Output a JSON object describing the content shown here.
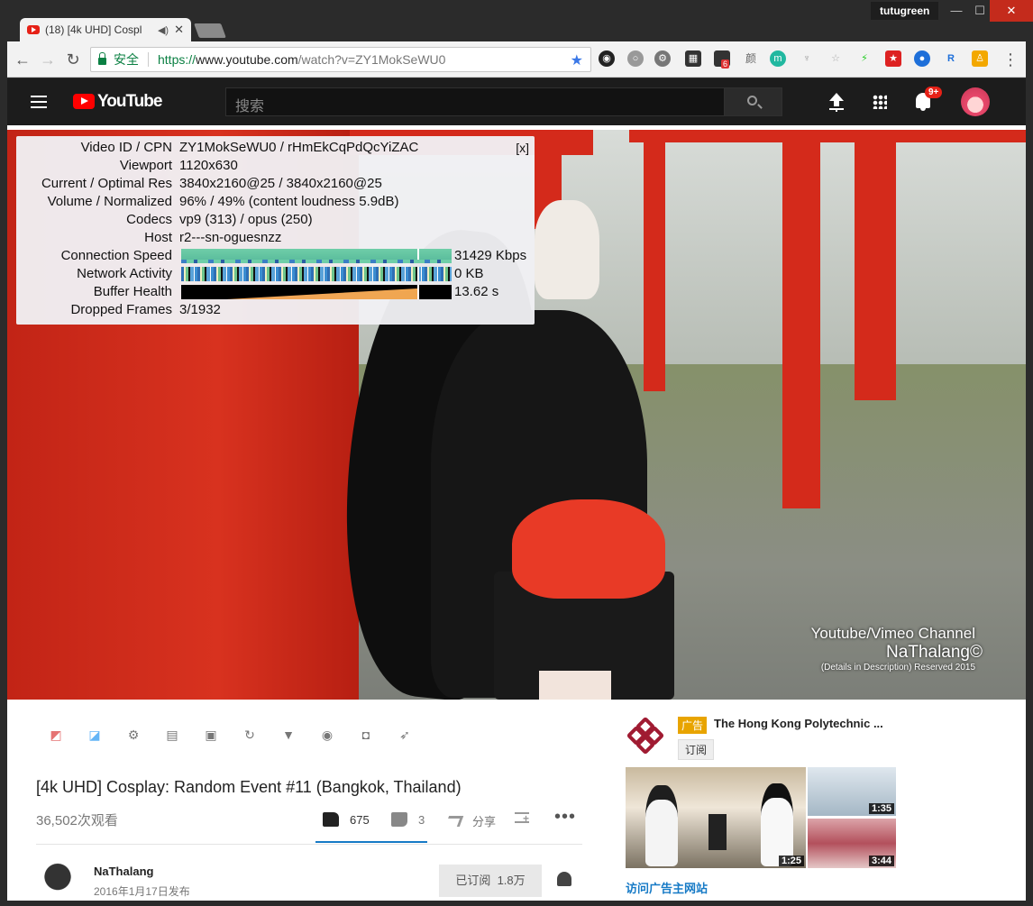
{
  "browser": {
    "tab_title": "(18) [4k UHD] Cospl",
    "tab_audio_icon": "speaker-icon",
    "user_name": "tutugreen",
    "secure_label": "安全",
    "url_scheme": "https://",
    "url_host": "www.youtube.com",
    "url_path": "/watch?v=ZY1MokSeWU0",
    "extension_badge": "6",
    "ext_text_yan": "颜"
  },
  "header": {
    "logo_text": "YouTube",
    "search_placeholder": "搜索",
    "notifications_badge": "9+"
  },
  "stats": {
    "close_label": "[x]",
    "rows": [
      {
        "key": "Video ID / CPN",
        "value": "ZY1MokSeWU0 / rHmEkCqPdQcYiZAC"
      },
      {
        "key": "Viewport",
        "value": "1120x630"
      },
      {
        "key": "Current / Optimal Res",
        "value": "3840x2160@25 / 3840x2160@25"
      },
      {
        "key": "Volume / Normalized",
        "value": "96% / 49% (content loudness 5.9dB)"
      },
      {
        "key": "Codecs",
        "value": "vp9 (313) / opus (250)"
      },
      {
        "key": "Host",
        "value": "r2---sn-oguesnzz"
      },
      {
        "key": "Connection Speed",
        "value": "31429 Kbps"
      },
      {
        "key": "Network Activity",
        "value": "0 KB"
      },
      {
        "key": "Buffer Health",
        "value": "13.62 s"
      },
      {
        "key": "Dropped Frames",
        "value": "3/1932"
      }
    ]
  },
  "watermark": {
    "line1": "Youtube/Vimeo Channel",
    "line2": "NaThalang©",
    "line3": "(Details in Description) Reserved 2015"
  },
  "video": {
    "title": "[4k UHD] Cosplay: Random Event #11 (Bangkok, Thailand)",
    "views": "36,502次观看",
    "likes": "675",
    "dislikes": "3",
    "share_label": "分享",
    "channel_name": "NaThalang",
    "published": "2016年1月17日发布",
    "subscribe_label": "已订阅",
    "subscriber_count": "1.8万"
  },
  "action_icons": [
    "pip-icon",
    "popout-icon",
    "gear-icon",
    "film-icon",
    "screenshot-icon",
    "loop-icon",
    "filter-icon",
    "globe-icon",
    "camera-icon",
    "rocket-icon"
  ],
  "ad": {
    "tag": "广告",
    "advertiser": "The Hong Kong Polytechnic ...",
    "subscribe_label": "订阅",
    "visit_label": "访问广告主网站",
    "duration_small_1": "1:35",
    "duration_small_2": "3:44",
    "duration_main": "1:25"
  }
}
